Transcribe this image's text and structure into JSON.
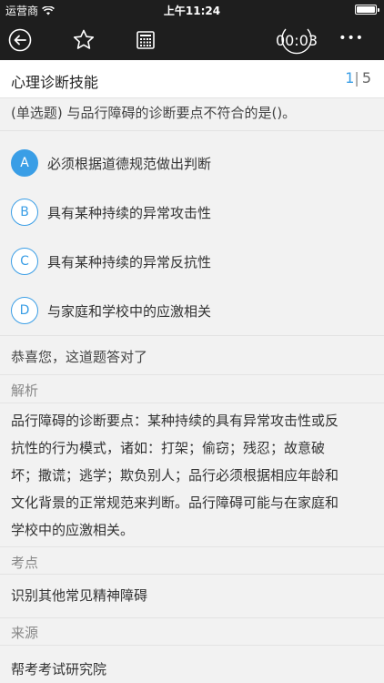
{
  "status_bar": {
    "carrier": "运营商",
    "time": "上午11:24"
  },
  "nav": {
    "timer": "00:03",
    "more": "•••"
  },
  "header": {
    "title": "心理诊断技能",
    "current": "1",
    "separator": "|",
    "total": "5"
  },
  "question": {
    "text": "(单选题) 与品行障碍的诊断要点不符合的是()。"
  },
  "options": [
    {
      "letter": "A",
      "text": "必须根据道德规范做出判断",
      "selected": true
    },
    {
      "letter": "B",
      "text": "具有某种持续的异常攻击性",
      "selected": false
    },
    {
      "letter": "C",
      "text": "具有某种持续的异常反抗性",
      "selected": false
    },
    {
      "letter": "D",
      "text": "与家庭和学校中的应激相关",
      "selected": false
    }
  ],
  "result": {
    "text": "恭喜您，这道题答对了"
  },
  "analysis": {
    "label": "解析",
    "lines": [
      "品行障碍的诊断要点：某种持续的具有异常攻击性或反",
      "抗性的行为模式，诸如：打架；偷窃；残忍；故意破",
      "坏；撒谎；逃学；欺负别人；品行必须根据相应年龄和",
      "文化背景的正常规范来判断。品行障碍可能与在家庭和",
      "学校中的应激相关。"
    ]
  },
  "point": {
    "label": "考点",
    "text": "识别其他常见精神障碍"
  },
  "source": {
    "label": "来源",
    "text": "帮考考试研究院"
  },
  "colors": {
    "accent": "#3a9ee6",
    "nav_bg": "#1e1e1e"
  }
}
